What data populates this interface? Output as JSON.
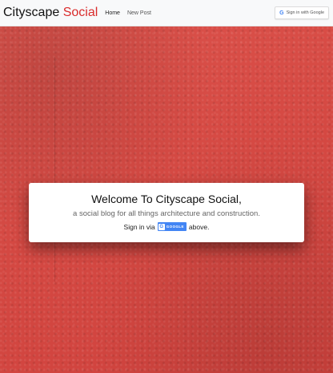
{
  "navbar": {
    "brand_main": "Cityscape ",
    "brand_accent": "Social",
    "links": [
      {
        "label": "Home"
      },
      {
        "label": "New Post"
      }
    ],
    "signin": {
      "icon": "google-icon",
      "icon_glyph": "G",
      "label": "Sign in with Google"
    }
  },
  "hero": {
    "background_color": "#d64a45"
  },
  "card": {
    "title": "Welcome To Cityscape Social,",
    "subtitle": "a social blog for all things architecture and construction.",
    "signin_prefix": "Sign in via",
    "google_badge": {
      "glyph": "G",
      "label": "GOOGLE"
    },
    "signin_suffix": "above."
  },
  "colors": {
    "accent": "#d92b2b",
    "google_blue": "#4285f4"
  }
}
